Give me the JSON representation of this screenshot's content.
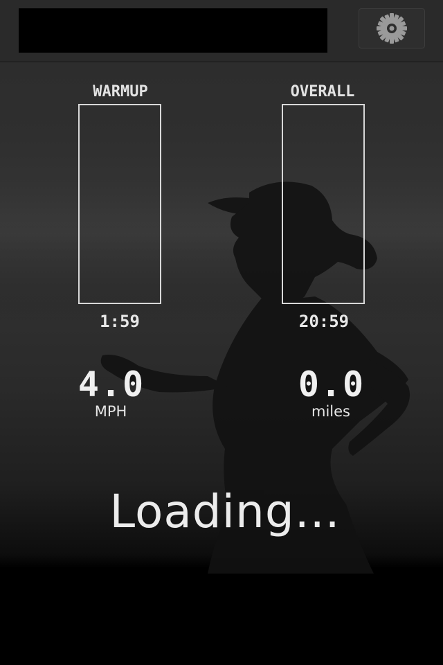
{
  "header": {
    "title_text": "",
    "settings_icon": "gear-icon"
  },
  "warmup": {
    "label": "WARMUP",
    "time": "1:59",
    "progress": 0
  },
  "overall": {
    "label": "OVERALL",
    "time": "20:59",
    "progress": 0
  },
  "speed": {
    "value": "4.0",
    "unit": "MPH"
  },
  "distance": {
    "value": "0.0",
    "unit": "miles"
  },
  "status": {
    "text": "Loading..."
  },
  "colors": {
    "background": "#2f2f2f",
    "text": "#e8e8e8",
    "accent": "#d8d8d8"
  }
}
